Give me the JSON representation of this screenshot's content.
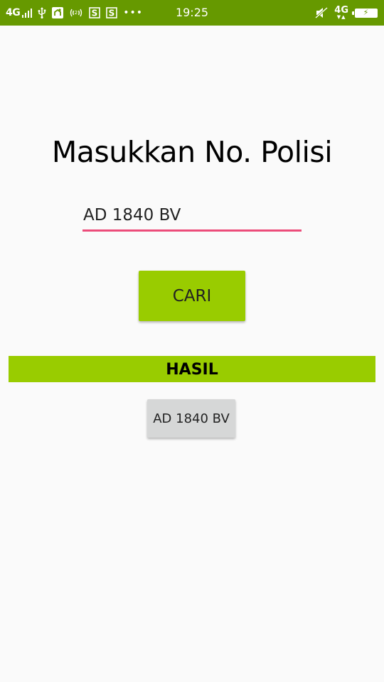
{
  "status_bar": {
    "network_left": "4G",
    "network_right": "4G",
    "time": "19:25",
    "more_indicator": "•••",
    "background_color": "#669900",
    "icons": [
      "signal-icon",
      "usb-icon",
      "app-notification-icon",
      "hotspot-icon",
      "s-notification-icon",
      "s-notification-icon",
      "muted-icon",
      "battery-charging-icon"
    ]
  },
  "main": {
    "title": "Masukkan No. Polisi",
    "plate_input": {
      "value": "AD 1840 BV",
      "underline_color": "#ec4c7a"
    },
    "search_button": {
      "label": "CARI",
      "color": "#99cc00"
    },
    "result_header": {
      "label": "HASIL",
      "color": "#99cc00"
    },
    "result_item": {
      "label": "AD 1840 BV"
    }
  }
}
